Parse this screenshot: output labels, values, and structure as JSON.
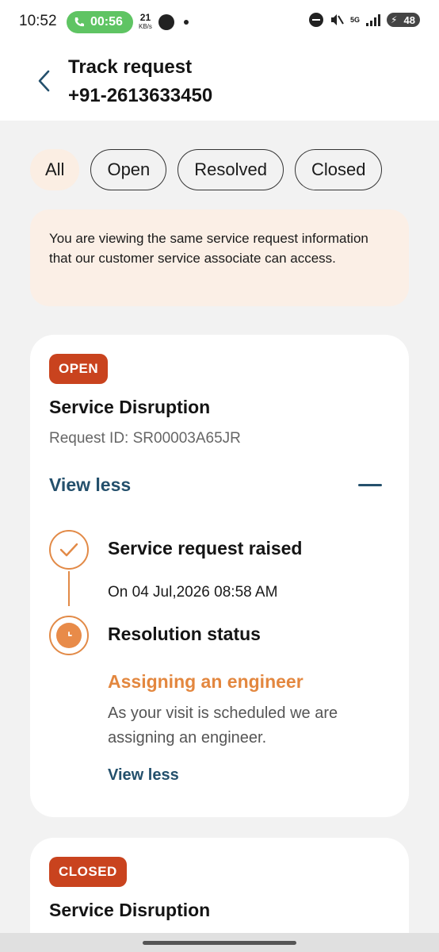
{
  "status_bar": {
    "time": "10:52",
    "call_duration": "00:56",
    "net_speed_value": "21",
    "net_speed_unit": "KB/s",
    "network_type": "5G",
    "battery": "48"
  },
  "header": {
    "title": "Track request",
    "subtitle": "+91-2613633450"
  },
  "filters": [
    {
      "label": "All",
      "active": true
    },
    {
      "label": "Open",
      "active": false
    },
    {
      "label": "Resolved",
      "active": false
    },
    {
      "label": "Closed",
      "active": false
    }
  ],
  "info_text": "You are viewing the same service request information that our customer service associate can access.",
  "requests": [
    {
      "status": "OPEN",
      "title": "Service Disruption",
      "request_id": "Request ID: SR00003A65JR",
      "toggle_label": "View less",
      "timeline": [
        {
          "title": "Service request raised",
          "detail": "On 04 Jul,2026 08:58 AM"
        },
        {
          "title": "Resolution status",
          "status": "Assigning an engineer",
          "description": "As your visit is scheduled we are assigning an engineer.",
          "link": "View less"
        }
      ]
    },
    {
      "status": "CLOSED",
      "title": "Service Disruption"
    }
  ],
  "colors": {
    "accent_orange": "#e3873f",
    "badge_red": "#c9431e",
    "link_blue": "#24506c",
    "info_bg": "#fbefe6"
  }
}
